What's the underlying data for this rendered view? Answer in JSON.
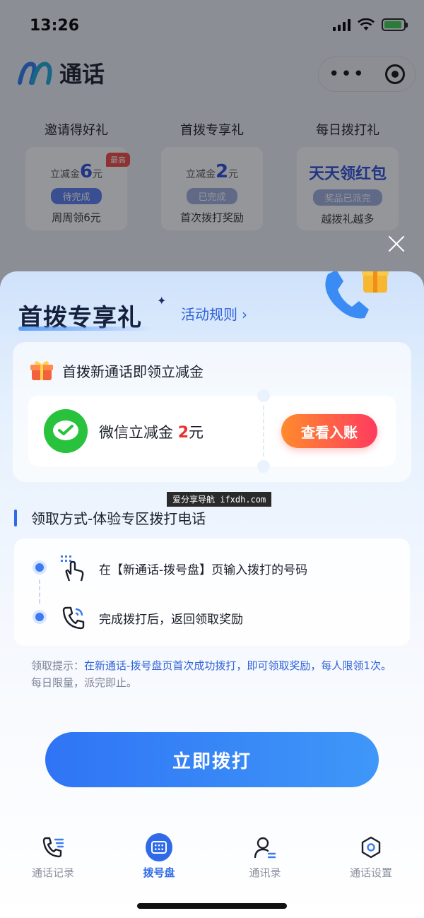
{
  "status_bar": {
    "time": "13:26"
  },
  "app": {
    "title": "通话"
  },
  "promos": [
    {
      "title": "邀请得好礼",
      "amount_prefix": "立减金",
      "amount": "6",
      "amount_unit": "元",
      "tag": "最高",
      "badge": "待完成",
      "sub": "周周领6元"
    },
    {
      "title": "首拨专享礼",
      "amount_prefix": "立减金",
      "amount": "2",
      "amount_unit": "元",
      "badge": "已完成",
      "sub": "首次拨打奖励"
    },
    {
      "title": "每日拨打礼",
      "big": "天天领红包",
      "badge": "奖品已派完",
      "sub": "越拨礼越多"
    }
  ],
  "sheet": {
    "title": "首拨专享礼",
    "rules_link": "活动规则",
    "rules_chevron": "›",
    "gift_header": "首拨新通话即领立减金",
    "coupon_label": "微信立减金",
    "coupon_amount": "2",
    "coupon_unit": "元",
    "view_button": "查看入账",
    "watermark": "爱分享导航 ifxdh.com",
    "method_title": "领取方式-体验专区拨打电话",
    "steps": [
      {
        "text": "在【新通话-拨号盘】页输入拨打的号码"
      },
      {
        "text": "完成拨打后，返回领取奖励"
      }
    ],
    "tips_prefix": "领取提示：",
    "tips_highlight": "在新通话-拨号盘页首次成功拨打，即可领取奖励，每人限领1次。",
    "tips_suffix": "每日限量，派完即止。",
    "dial_button": "立即拨打"
  },
  "tabbar": [
    {
      "label": "通话记录",
      "icon": "phone-log-icon",
      "active": false
    },
    {
      "label": "拨号盘",
      "icon": "dialpad-icon",
      "active": true
    },
    {
      "label": "通讯录",
      "icon": "contacts-icon",
      "active": false
    },
    {
      "label": "通话设置",
      "icon": "settings-icon",
      "active": false
    }
  ],
  "colors": {
    "accent": "#2f6be9",
    "highlight": "#e8322e",
    "wechat": "#29c23d",
    "view_button_start": "#ff8b2d",
    "view_button_end": "#ff3b5f"
  }
}
